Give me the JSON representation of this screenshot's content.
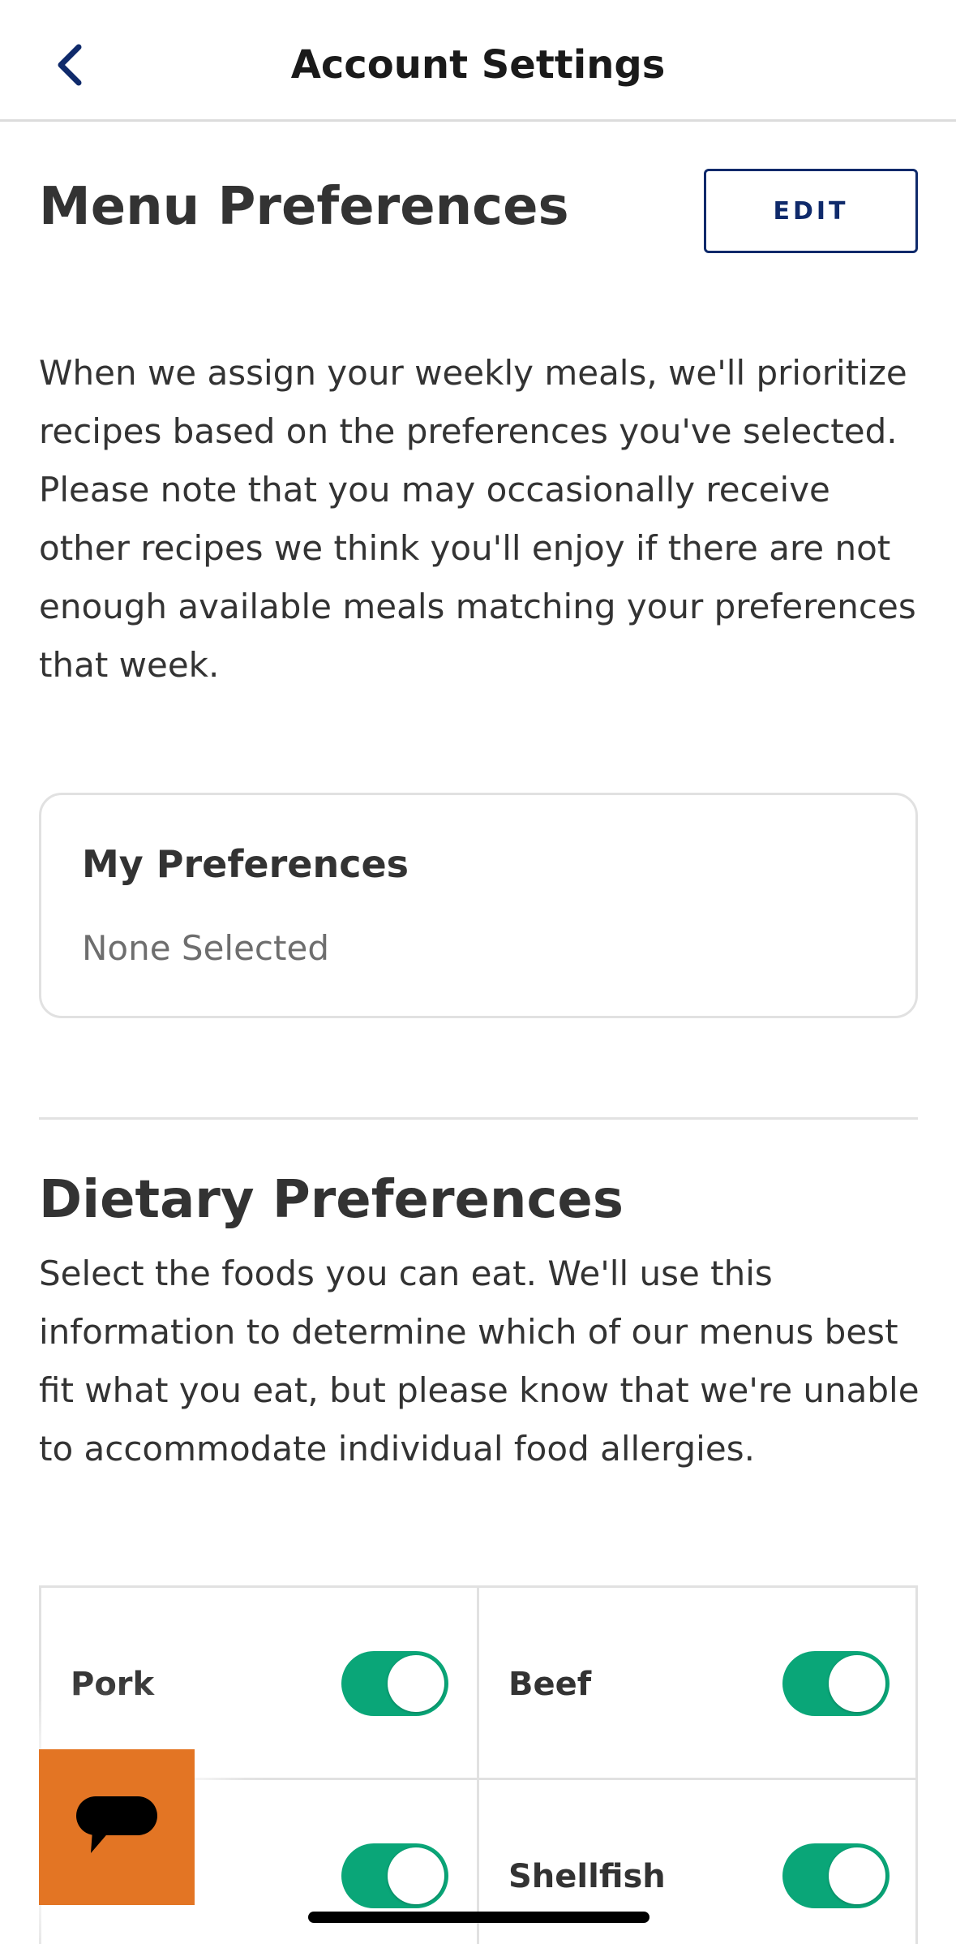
{
  "header": {
    "title": "Account Settings",
    "back_icon": "chevron-left-icon"
  },
  "menu_preferences": {
    "title": "Menu Preferences",
    "edit_label": "EDIT",
    "description": "When we assign your weekly meals, we'll prioritize recipes based on the preferences you've selected. Please note that you may occasionally receive other recipes we think you'll enjoy if there are not enough available meals matching your preferences that week.",
    "card": {
      "title": "My Preferences",
      "value": "None Selected"
    }
  },
  "dietary_preferences": {
    "title": "Dietary Preferences",
    "description": "Select the foods you can eat. We'll use this information to determine which of our menus best fit what you eat, but please know that we're unable to accommodate individual food allergies.",
    "items": [
      {
        "label": "Pork",
        "enabled": true
      },
      {
        "label": "Beef",
        "enabled": true
      },
      {
        "label": "",
        "enabled": true
      },
      {
        "label": "Shellfish",
        "enabled": true
      }
    ]
  },
  "chat": {
    "icon": "chat-bubble-icon"
  },
  "colors": {
    "accent_navy": "#0f2a6b",
    "toggle_on": "#0aa678",
    "chat_orange": "#e37524"
  }
}
